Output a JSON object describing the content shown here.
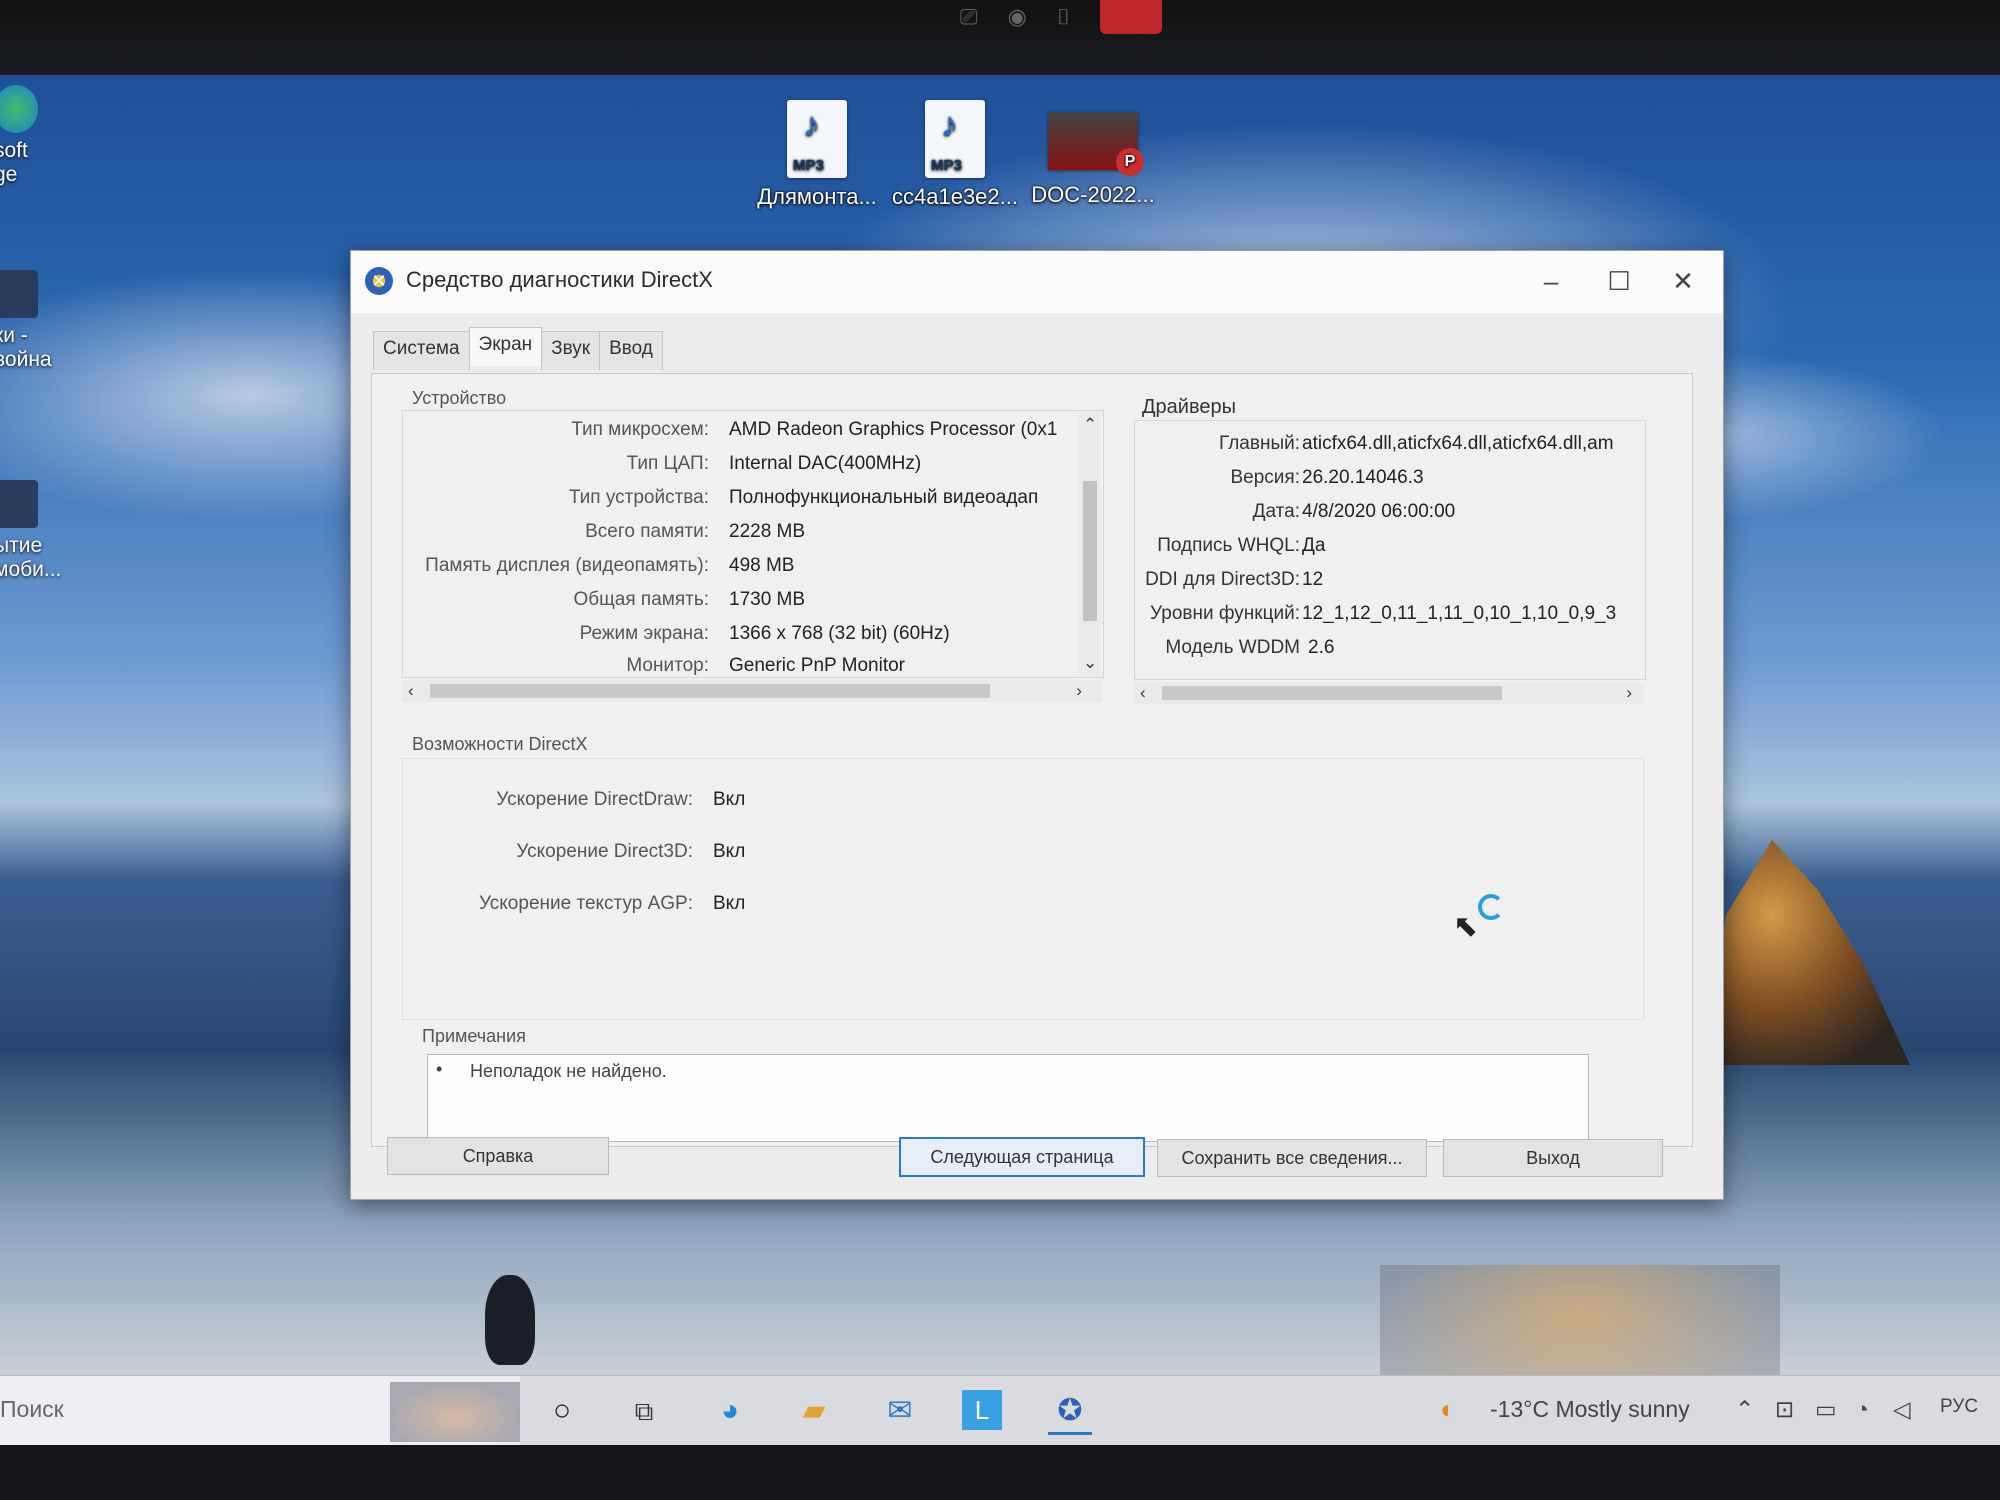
{
  "desktop": {
    "icons": [
      {
        "label": "Длямонта...",
        "kind": "mp3",
        "tag": "MP3"
      },
      {
        "label": "cc4a1e3e2...",
        "kind": "mp3",
        "tag": "MP3"
      },
      {
        "label": "DOC-2022...",
        "kind": "pptx",
        "tag": "P"
      }
    ],
    "left_icons": [
      {
        "label": "soft\nge"
      },
      {
        "label": "ки -\nвойна"
      },
      {
        "label": "ытие\nмоби..."
      }
    ]
  },
  "window": {
    "title": "Средство диагностики DirectX",
    "controls": {
      "minimize": "–",
      "maximize": "☐",
      "close": "✕"
    },
    "tabs": [
      {
        "label": "Система",
        "active": false
      },
      {
        "label": "Экран",
        "active": true
      },
      {
        "label": "Звук",
        "active": false
      },
      {
        "label": "Ввод",
        "active": false
      }
    ],
    "device": {
      "title": "Устройство",
      "rows": [
        {
          "label": "Тип микросхем:",
          "value": "AMD Radeon Graphics Processor (0x1"
        },
        {
          "label": "Тип ЦАП:",
          "value": "Internal DAC(400MHz)"
        },
        {
          "label": "Тип устройства:",
          "value": "Полнофункциональный видеоадап"
        },
        {
          "label": "Всего памяти:",
          "value": "2228 MB"
        },
        {
          "label": "Память дисплея (видеопамять):",
          "value": "498 MB"
        },
        {
          "label": "Общая память:",
          "value": "1730 MB"
        },
        {
          "label": "Режим экрана:",
          "value": "1366 x 768 (32 bit) (60Hz)"
        },
        {
          "label": "Монитор:",
          "value": "Generic PnP Monitor"
        }
      ]
    },
    "drivers": {
      "title": "Драйверы",
      "rows": [
        {
          "label": "Главный:",
          "value": "aticfx64.dll,aticfx64.dll,aticfx64.dll,am"
        },
        {
          "label": "Версия:",
          "value": "26.20.14046.3"
        },
        {
          "label": "Дата:",
          "value": "4/8/2020 06:00:00"
        },
        {
          "label": "Подпись WHQL:",
          "value": "Да"
        },
        {
          "label": "DDI для Direct3D:",
          "value": "12"
        },
        {
          "label": "Уровни функций:",
          "value": "12_1,12_0,11_1,11_0,10_1,10_0,9_3"
        },
        {
          "label": "Модель WDDM",
          "value": "2.6"
        }
      ]
    },
    "directx": {
      "title": "Возможности DirectX",
      "rows": [
        {
          "label": "Ускорение DirectDraw:",
          "value": "Вкл"
        },
        {
          "label": "Ускорение Direct3D:",
          "value": "Вкл"
        },
        {
          "label": "Ускорение текстур AGP:",
          "value": "Вкл"
        }
      ]
    },
    "notes": {
      "title": "Примечания",
      "items": [
        "Неполадок не найдено."
      ]
    },
    "buttons": {
      "help": "Справка",
      "next": "Следующая страница",
      "save": "Сохранить все сведения...",
      "exit": "Выход"
    }
  },
  "taskbar": {
    "search_placeholder": "Поиск",
    "weather": "-13°C  Mostly sunny",
    "lang": "РУС",
    "icons": [
      "cortana-icon",
      "task-view-icon",
      "edge-icon",
      "file-explorer-icon",
      "mail-icon",
      "app-l-icon",
      "directx-icon"
    ]
  },
  "colors": {
    "accent": "#2b78c9",
    "window_bg": "#ececec"
  }
}
